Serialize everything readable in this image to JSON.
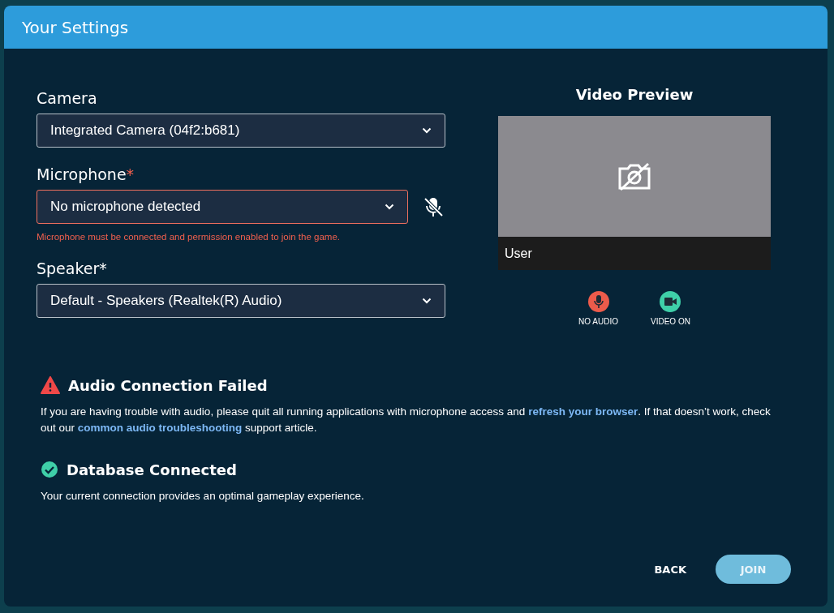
{
  "window": {
    "title": "Your Settings"
  },
  "fields": [
    {
      "label": "Camera",
      "invalid": false,
      "value": "Integrated Camera (04f2:b681)",
      "muted": false
    },
    {
      "label": "Microphone",
      "required_mark": "*",
      "invalid": true,
      "value": "No microphone detected",
      "muted": true,
      "message": "Microphone must be connected and permission enabled to join the game."
    },
    {
      "label": "Speaker",
      "required_mark": "*",
      "invalid": false,
      "value": "Default - Speakers (Realtek(R) Audio)",
      "muted": false
    }
  ],
  "preview": {
    "title": "Video Preview",
    "camera_off": true,
    "user_label": "User",
    "statuses": [
      {
        "kind": "audio",
        "label": "NO AUDIO",
        "on": false
      },
      {
        "kind": "video",
        "label": "VIDEO ON",
        "on": true
      }
    ]
  },
  "notices": [
    {
      "kind": "error",
      "title": "Audio Connection Failed",
      "text": [
        {
          "text": "If you are having trouble with audio, please quit all running applications with microphone access and ",
          "link": false
        },
        {
          "text": "refresh your browser",
          "link": true
        },
        {
          "text": ". If that doesn’t work, check out our ",
          "link": false
        },
        {
          "text": "common audio troubleshooting",
          "link": true
        },
        {
          "text": " support article.",
          "link": false
        }
      ]
    },
    {
      "kind": "success",
      "title": "Database Connected",
      "text": [
        {
          "text": "Your current connection provides an optimal gameplay experience.",
          "link": false
        }
      ]
    }
  ],
  "buttons": [
    {
      "label": "BACK",
      "kind": "text",
      "disabled": false
    },
    {
      "label": "JOIN",
      "kind": "primary",
      "disabled": true
    }
  ]
}
